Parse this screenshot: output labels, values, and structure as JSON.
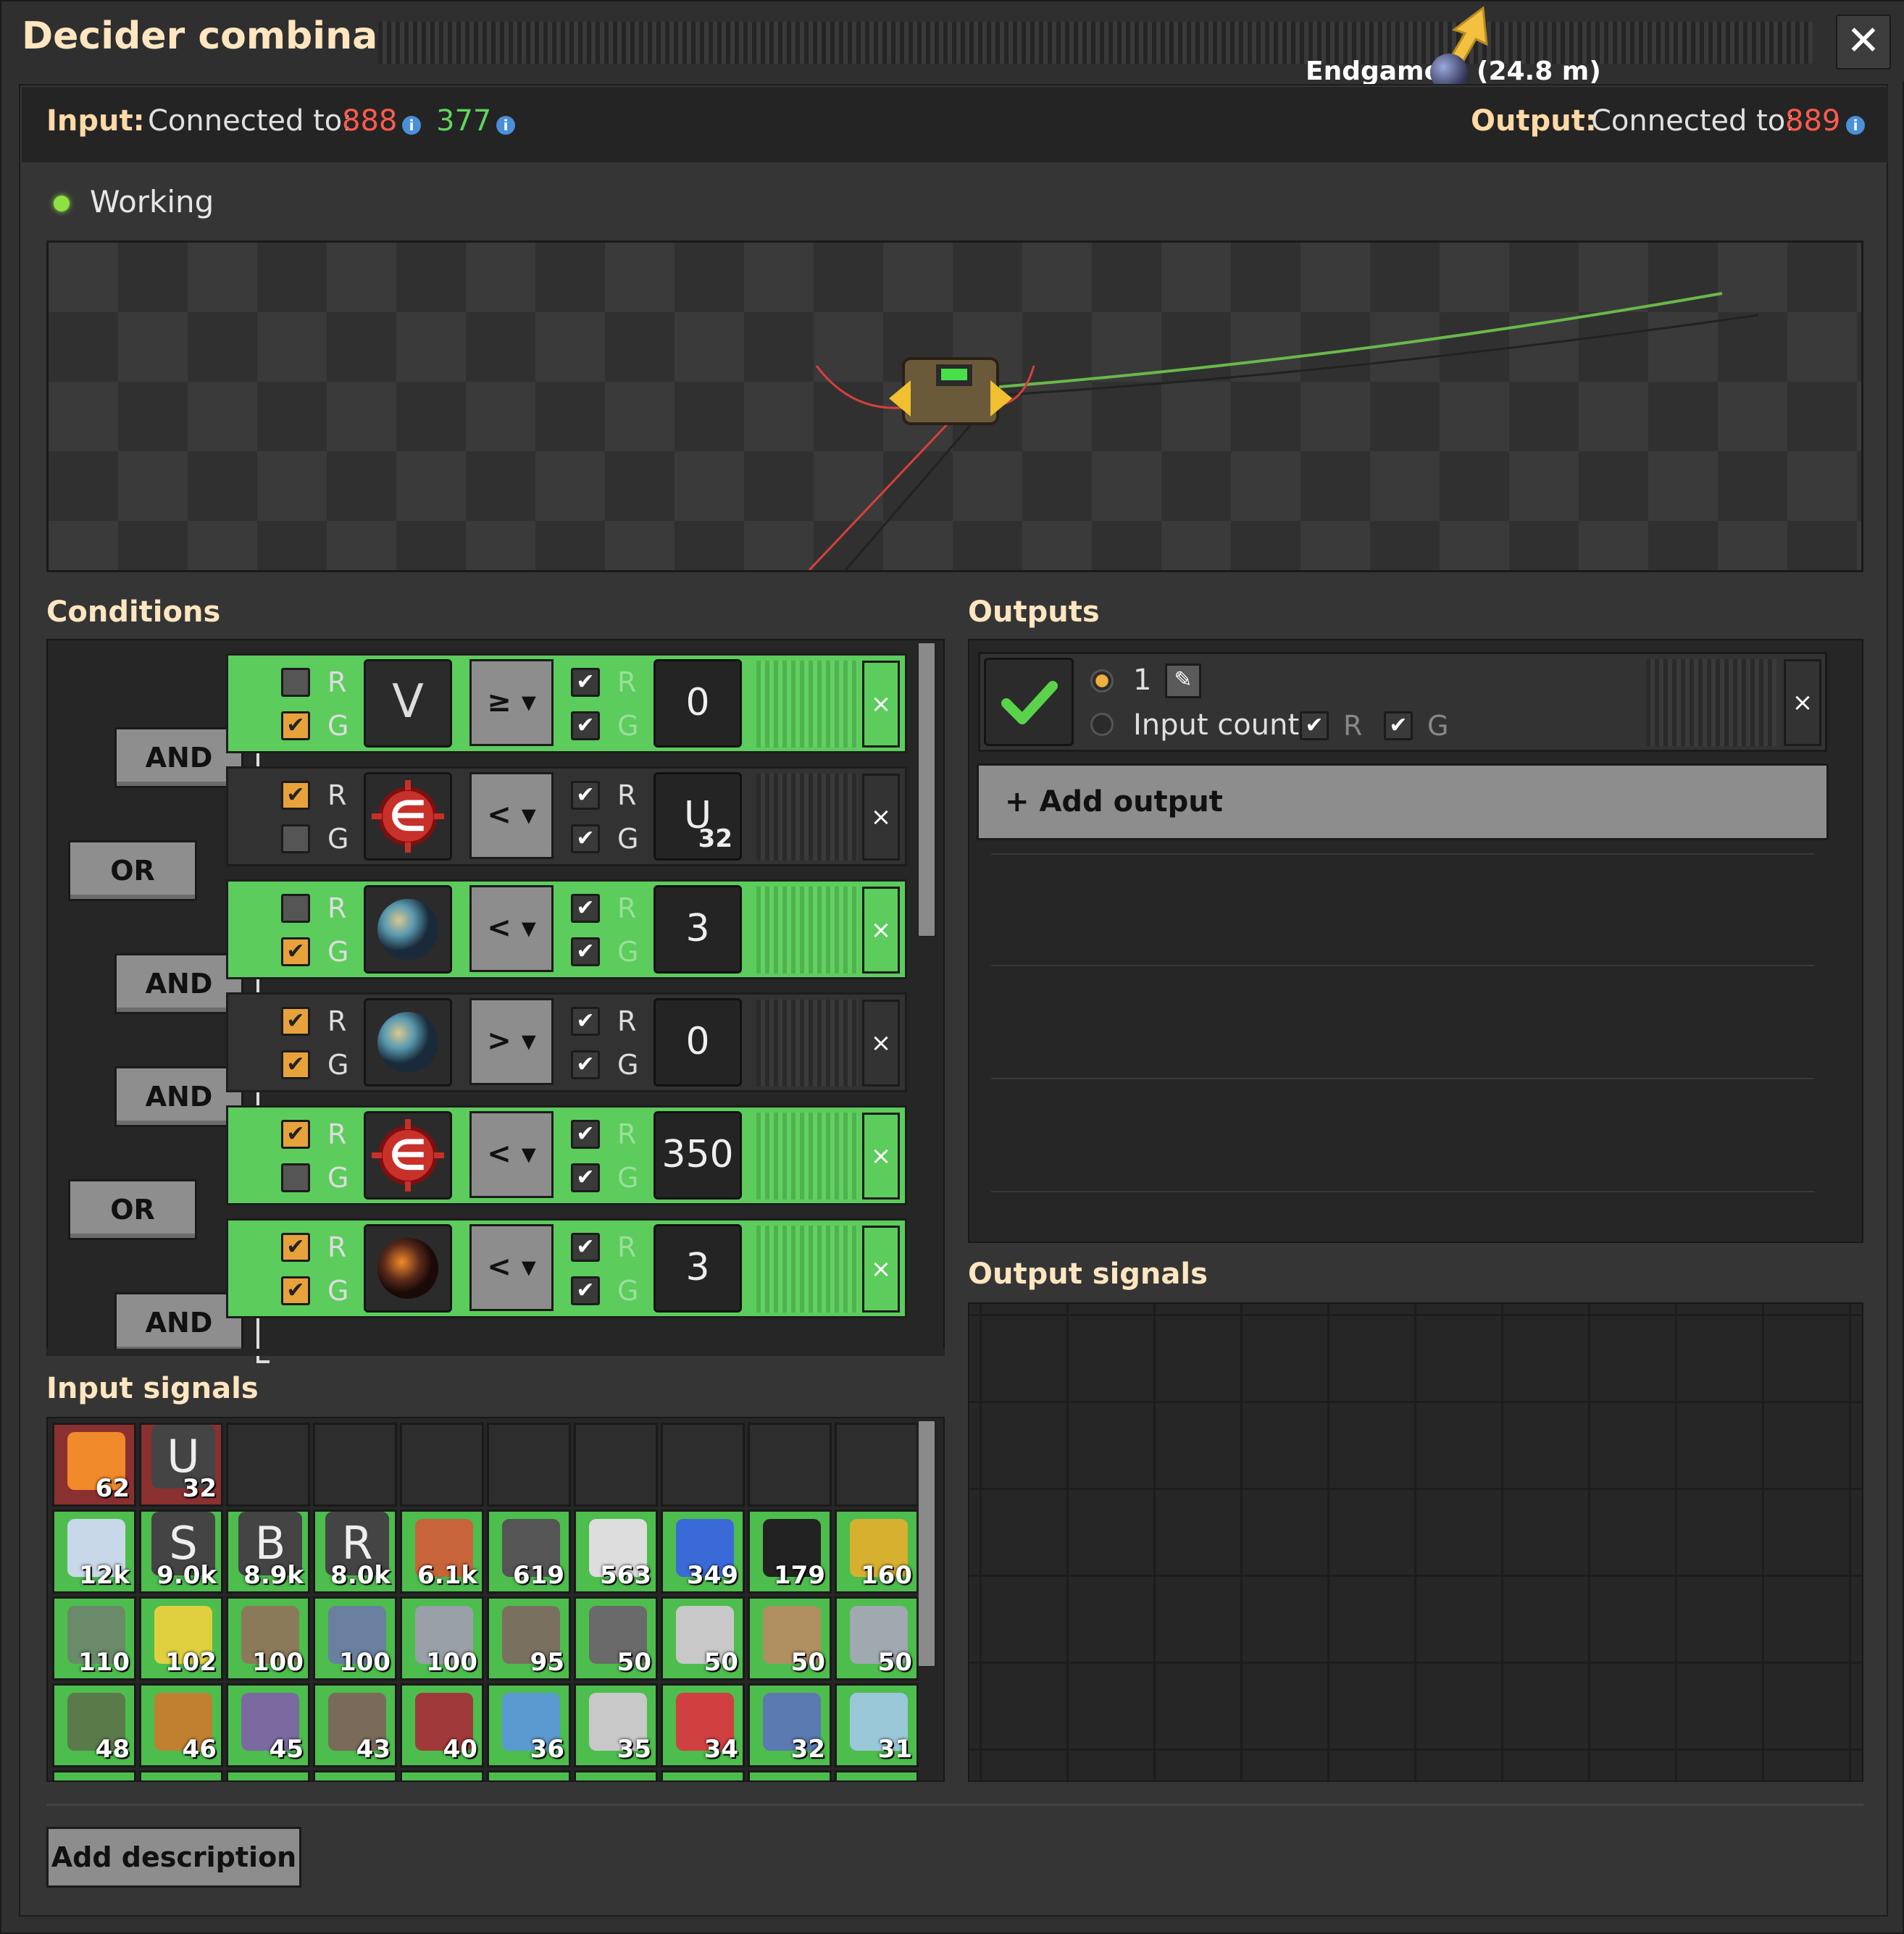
{
  "window": {
    "title": "Decider combinator",
    "close_icon": "close-icon"
  },
  "location": {
    "name": "Endgame",
    "distance": "(24.8 m)"
  },
  "connections": {
    "input_label": "Input:",
    "connected_label": "Connected to:",
    "input_red": "888",
    "input_green": "377",
    "output_label": "Output:",
    "output_red": "889"
  },
  "status": {
    "text": "Working",
    "color": "#8fe043"
  },
  "sections": {
    "conditions": "Conditions",
    "outputs": "Outputs",
    "output_signals": "Output signals",
    "input_signals": "Input signals"
  },
  "logic_buttons": [
    {
      "label": "AND"
    },
    {
      "label": "OR"
    },
    {
      "label": "AND"
    },
    {
      "label": "AND"
    },
    {
      "label": "OR"
    },
    {
      "label": "AND"
    }
  ],
  "conditions": [
    {
      "left_r": false,
      "left_g": true,
      "signal": "V",
      "signal_icon": "letter-v-icon",
      "op": "≥",
      "right_r": true,
      "right_g": true,
      "value": "0",
      "value_sub": "",
      "active": true
    },
    {
      "left_r": true,
      "left_g": false,
      "signal": "",
      "signal_icon": "everything-icon",
      "op": "<",
      "right_r": true,
      "right_g": true,
      "value": "U",
      "value_sub": "32",
      "active": false
    },
    {
      "left_r": false,
      "left_g": true,
      "signal": "",
      "signal_icon": "planet-nauvis-icon",
      "op": "<",
      "right_r": true,
      "right_g": true,
      "value": "3",
      "value_sub": "",
      "active": true
    },
    {
      "left_r": true,
      "left_g": true,
      "signal": "",
      "signal_icon": "planet-nauvis-icon",
      "op": ">",
      "right_r": true,
      "right_g": true,
      "value": "0",
      "value_sub": "",
      "active": false
    },
    {
      "left_r": true,
      "left_g": false,
      "signal": "",
      "signal_icon": "everything-icon",
      "op": "<",
      "right_r": true,
      "right_g": true,
      "value": "350",
      "value_sub": "",
      "active": true
    },
    {
      "left_r": true,
      "left_g": true,
      "signal": "",
      "signal_icon": "planet-vulcanus-icon",
      "op": "<",
      "right_r": true,
      "right_g": true,
      "value": "3",
      "value_sub": "",
      "active": true
    }
  ],
  "rg_labels": {
    "r": "R",
    "g": "G"
  },
  "output": {
    "check_icon": "check-icon",
    "value": "1",
    "input_count_label": "Input count",
    "edit_icon": "pencil-icon",
    "add_output_label": "+ Add output"
  },
  "input_signals": {
    "red": [
      {
        "icon": "fire-icon",
        "color": "#f08a2a",
        "count": "62"
      },
      {
        "letter": "U",
        "count": "32"
      }
    ],
    "green": [
      {
        "icon": "ice-icon",
        "color": "#c8d8e8",
        "count": "12k"
      },
      {
        "letter": "S",
        "count": "9.0k"
      },
      {
        "letter": "B",
        "count": "8.9k"
      },
      {
        "letter": "R",
        "count": "8.0k"
      },
      {
        "icon": "copper-ore-icon",
        "color": "#c8643a",
        "count": "6.1k"
      },
      {
        "icon": "coal-icon",
        "color": "#555555",
        "count": "619"
      },
      {
        "icon": "rocket-part-icon",
        "color": "#dddddd",
        "count": "563"
      },
      {
        "icon": "rocket-icon",
        "color": "#3a6ad8",
        "count": "349"
      },
      {
        "icon": "carbon-icon",
        "color": "#222222",
        "count": "179"
      },
      {
        "icon": "repair-pack-icon",
        "color": "#d8b030",
        "count": "160"
      },
      {
        "icon": "barrel-icon",
        "color": "#6a8a6a",
        "count": "110"
      },
      {
        "icon": "sulfur-icon",
        "color": "#e0d040",
        "count": "102"
      },
      {
        "icon": "pipe-icon",
        "color": "#8a7a5a",
        "count": "100"
      },
      {
        "icon": "iron-ore-icon",
        "color": "#6a80a0",
        "count": "100"
      },
      {
        "icon": "asteroid-icon",
        "color": "#9aa0a8",
        "count": "100"
      },
      {
        "icon": "belt-icon",
        "color": "#7a7060",
        "count": "95"
      },
      {
        "icon": "splitter-icon",
        "color": "#6a6a6a",
        "count": "50"
      },
      {
        "icon": "inserter-icon",
        "color": "#c8c8c8",
        "count": "50"
      },
      {
        "icon": "boiler-icon",
        "color": "#b09060",
        "count": "50"
      },
      {
        "icon": "asteroid-chunk-icon",
        "color": "#a0a8b0",
        "count": "50"
      },
      {
        "icon": "landfill-icon",
        "color": "#5a7a4a",
        "count": "48"
      },
      {
        "icon": "turret-icon",
        "color": "#c08030",
        "count": "46"
      },
      {
        "icon": "iron-chunk-icon",
        "color": "#7a6aa0",
        "count": "45"
      },
      {
        "icon": "stone-icon",
        "color": "#7a6a5a",
        "count": "43"
      },
      {
        "icon": "uranium-icon",
        "color": "#a03a3a",
        "count": "40"
      },
      {
        "icon": "fast-inserter-icon",
        "color": "#5a9ad0",
        "count": "36"
      },
      {
        "icon": "gear-icon",
        "color": "#c8c8c8",
        "count": "35"
      },
      {
        "icon": "long-inserter-icon",
        "color": "#d04040",
        "count": "34"
      },
      {
        "icon": "solar-panel-icon",
        "color": "#5a7ab0",
        "count": "32"
      },
      {
        "icon": "ice-crystal-icon",
        "color": "#9ac8d8",
        "count": "31"
      }
    ]
  },
  "description": {
    "button_label": "Add description"
  }
}
